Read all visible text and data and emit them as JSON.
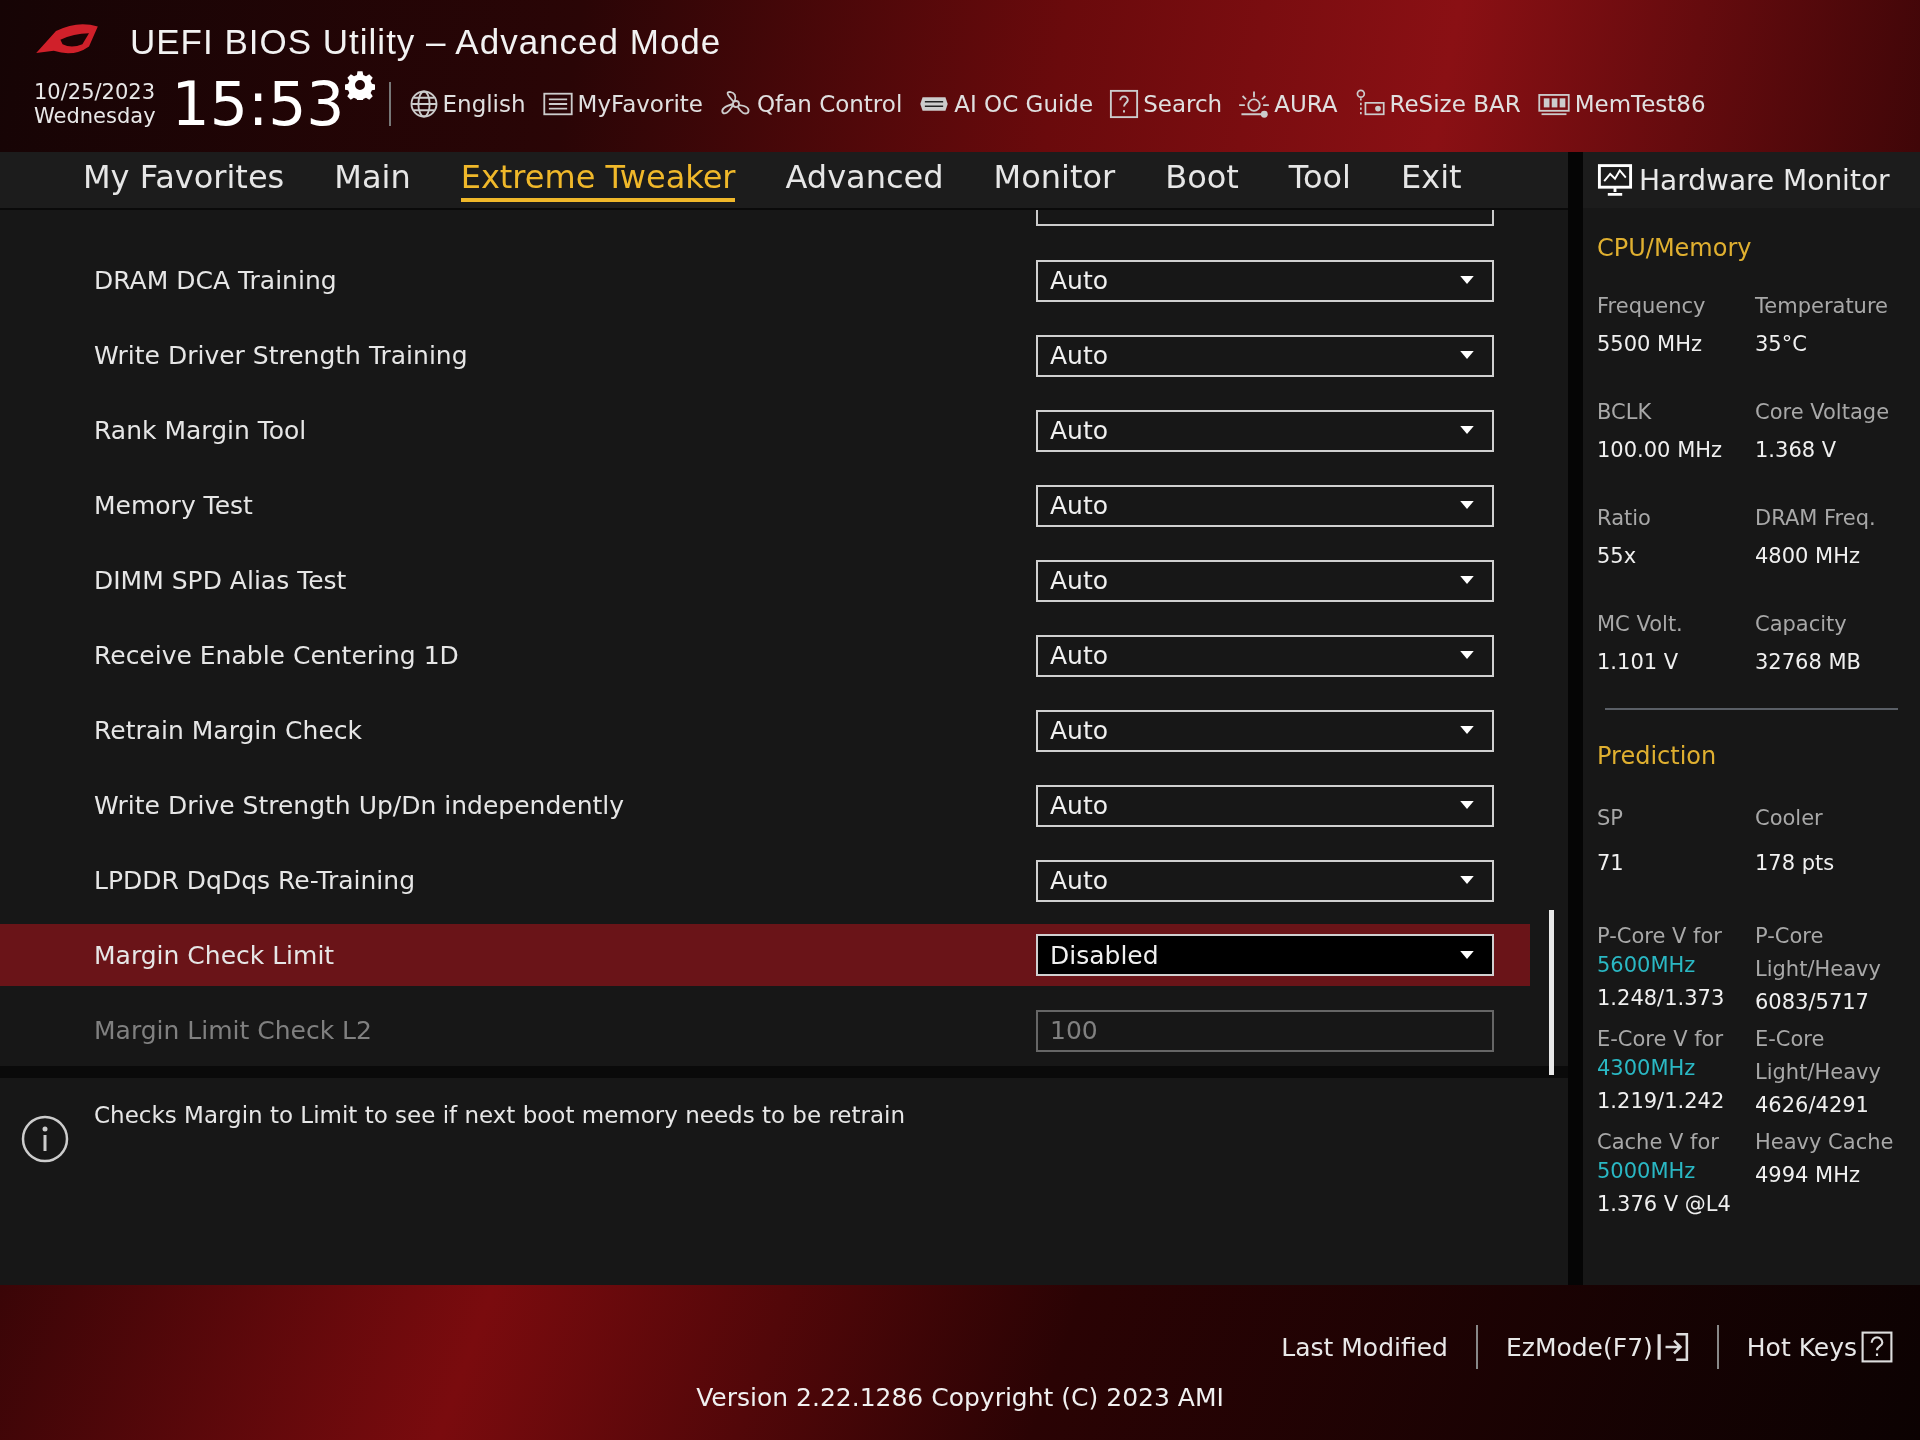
{
  "header": {
    "title": "UEFI BIOS Utility – Advanced Mode",
    "date": "10/25/2023",
    "day": "Wednesday",
    "time": "15:53",
    "tools": [
      {
        "label": "English",
        "kind": "globe"
      },
      {
        "label": "MyFavorite",
        "kind": "list"
      },
      {
        "label": "Qfan Control",
        "kind": "fan"
      },
      {
        "label": "AI OC Guide",
        "kind": "chip"
      },
      {
        "label": "Search",
        "kind": "help"
      },
      {
        "label": "AURA",
        "kind": "aura"
      },
      {
        "label": "ReSize BAR",
        "kind": "card"
      },
      {
        "label": "MemTest86",
        "kind": "memory"
      }
    ]
  },
  "tabs": [
    {
      "label": "My Favorites",
      "selected": false
    },
    {
      "label": "Main",
      "selected": false
    },
    {
      "label": "Extreme Tweaker",
      "selected": true
    },
    {
      "label": "Advanced",
      "selected": false
    },
    {
      "label": "Monitor",
      "selected": false
    },
    {
      "label": "Boot",
      "selected": false
    },
    {
      "label": "Tool",
      "selected": false
    },
    {
      "label": "Exit",
      "selected": false
    }
  ],
  "settings": [
    {
      "label": "DRAM DCA Training",
      "value": "Auto",
      "kind": "dropdown",
      "selected": false,
      "disabled": false
    },
    {
      "label": "Write Driver Strength Training",
      "value": "Auto",
      "kind": "dropdown",
      "selected": false,
      "disabled": false
    },
    {
      "label": "Rank Margin Tool",
      "value": "Auto",
      "kind": "dropdown",
      "selected": false,
      "disabled": false
    },
    {
      "label": "Memory Test",
      "value": "Auto",
      "kind": "dropdown",
      "selected": false,
      "disabled": false
    },
    {
      "label": "DIMM SPD Alias Test",
      "value": "Auto",
      "kind": "dropdown",
      "selected": false,
      "disabled": false
    },
    {
      "label": "Receive Enable Centering 1D",
      "value": "Auto",
      "kind": "dropdown",
      "selected": false,
      "disabled": false
    },
    {
      "label": "Retrain Margin Check",
      "value": "Auto",
      "kind": "dropdown",
      "selected": false,
      "disabled": false
    },
    {
      "label": "Write Drive Strength Up/Dn independently",
      "value": "Auto",
      "kind": "dropdown",
      "selected": false,
      "disabled": false
    },
    {
      "label": "LPDDR DqDqs Re-Training",
      "value": "Auto",
      "kind": "dropdown",
      "selected": false,
      "disabled": false
    },
    {
      "label": "Margin Check Limit",
      "value": "Disabled",
      "kind": "dropdown",
      "selected": true,
      "disabled": false
    },
    {
      "label": "Margin Limit Check L2",
      "value": "100",
      "kind": "input",
      "selected": false,
      "disabled": true
    }
  ],
  "help": "Checks Margin to Limit to see if next boot memory needs to be retrain",
  "monitor": {
    "title": "Hardware Monitor",
    "sections": [
      {
        "title": "CPU/Memory",
        "items": [
          {
            "label": "Frequency",
            "value": "5500 MHz"
          },
          {
            "label": "Temperature",
            "value": "35°C"
          },
          {
            "label": "BCLK",
            "value": "100.00 MHz"
          },
          {
            "label": "Core Voltage",
            "value": "1.368 V"
          },
          {
            "label": "Ratio",
            "value": "55x"
          },
          {
            "label": "DRAM Freq.",
            "value": "4800 MHz"
          },
          {
            "label": "MC Volt.",
            "value": "1.101 V"
          },
          {
            "label": "Capacity",
            "value": "32768 MB"
          }
        ]
      },
      {
        "title": "Prediction",
        "items": [
          {
            "label": "SP",
            "value": "71"
          },
          {
            "label": "Cooler",
            "value": "178 pts"
          },
          {
            "label": "P-Core V for",
            "highlight": "5600MHz",
            "value": "1.248/1.373"
          },
          {
            "label": "P-Core Light/Heavy",
            "value": "6083/5717"
          },
          {
            "label": "E-Core V for",
            "highlight": "4300MHz",
            "value": "1.219/1.242"
          },
          {
            "label": "E-Core Light/Heavy",
            "value": "4626/4291"
          },
          {
            "label": "Cache V for",
            "highlight": "5000MHz",
            "value": "1.376 V @L4"
          },
          {
            "label": "Heavy Cache",
            "value": "4994 MHz"
          }
        ]
      }
    ]
  },
  "footer": {
    "buttons": [
      {
        "label": "Last Modified",
        "kind": "text"
      },
      {
        "label": "EzMode(F7)",
        "kind": "exit"
      },
      {
        "label": "Hot Keys",
        "kind": "help"
      }
    ],
    "version": "Version 2.22.1286 Copyright (C) 2023 AMI"
  }
}
